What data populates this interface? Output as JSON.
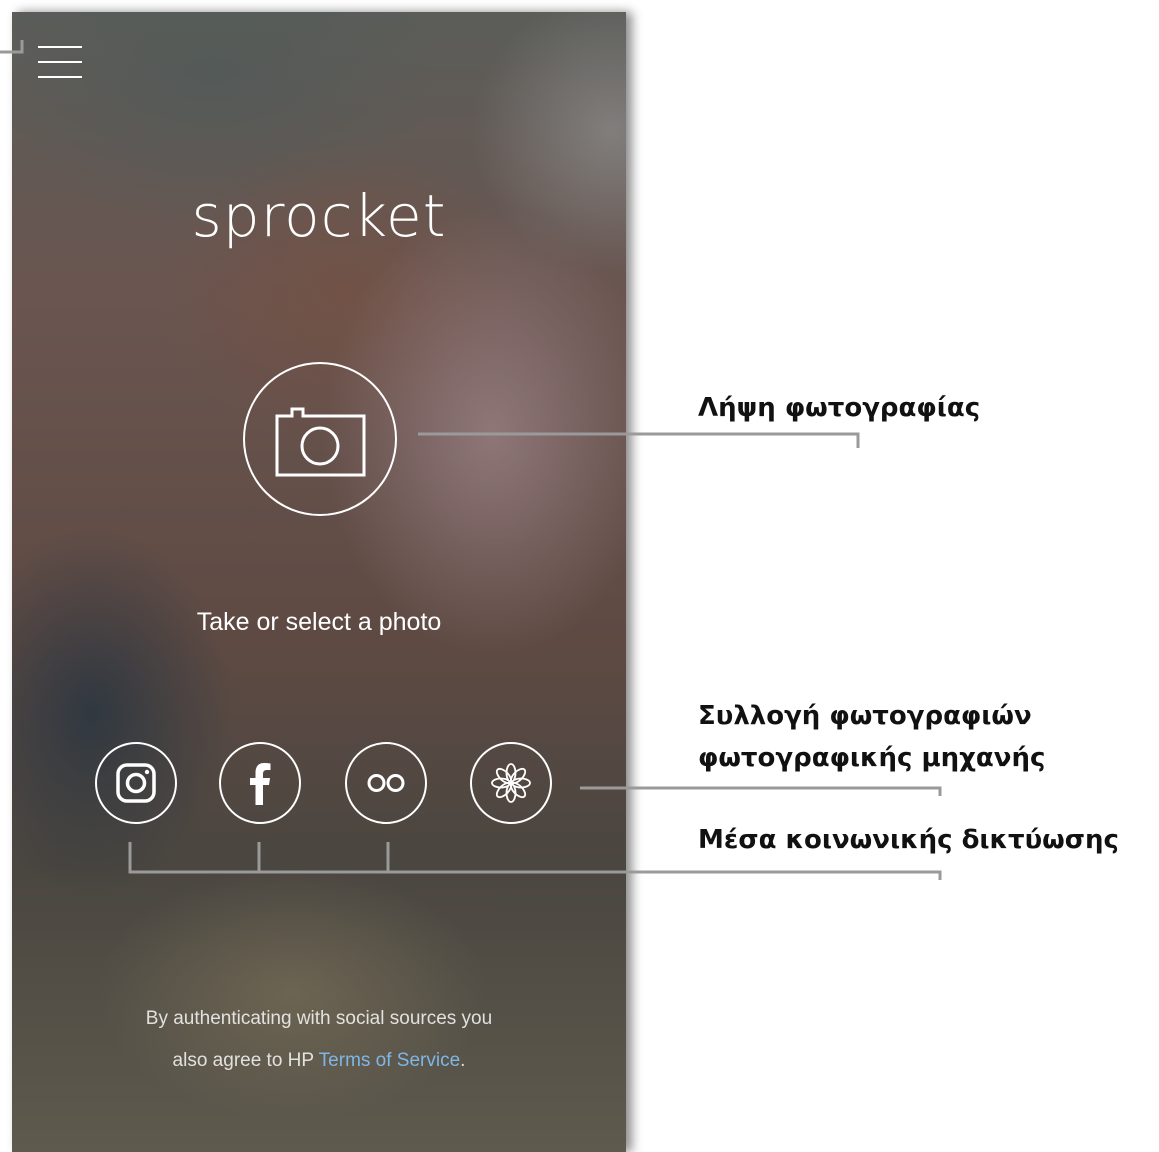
{
  "app": {
    "title": "sprocket",
    "prompt": "Take or select a photo",
    "legal_line1": "By authenticating with social sources you",
    "legal_line2_prefix": "also agree to HP ",
    "legal_link": "Terms of Service",
    "legal_suffix": "."
  },
  "icons": {
    "menu": "hamburger-menu-icon",
    "camera": "camera-icon",
    "instagram": "instagram-icon",
    "facebook": "facebook-icon",
    "flickr": "flickr-icon",
    "gallery": "flower-icon"
  },
  "callouts": {
    "take_photo": "Λήψη φωτογραφίας",
    "camera_roll_line1": "Συλλογή φωτογραφιών",
    "camera_roll_line2": "φωτογραφικής μηχανής",
    "social_media": "Μέσα κοινωνικής δικτύωσης"
  },
  "colors": {
    "link": "#7fb6e6",
    "leader_line": "#9a9a9a",
    "callout_text": "#111111"
  }
}
